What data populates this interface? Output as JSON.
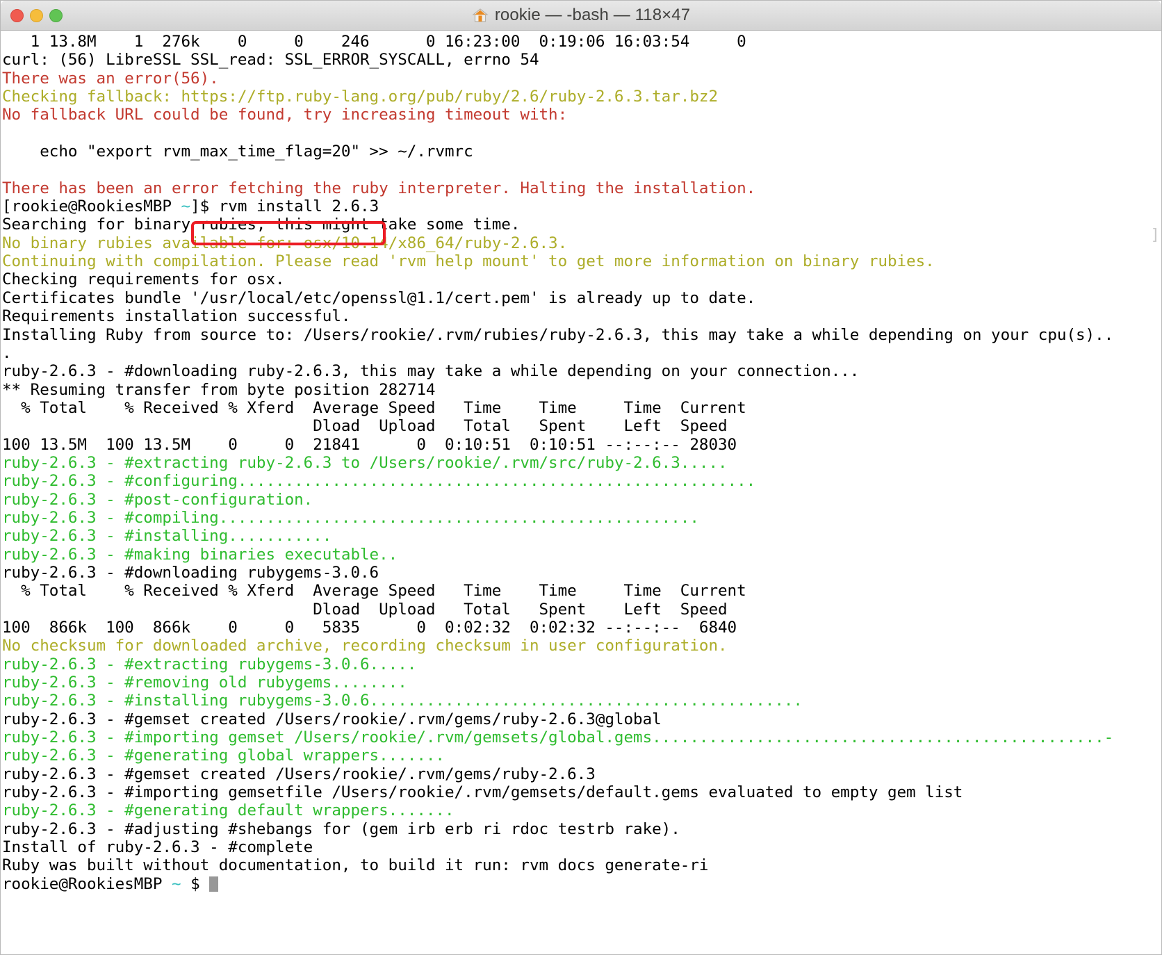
{
  "window": {
    "title": "rookie — -bash — 118×47",
    "icon": "home-icon",
    "buttons": {
      "close": "close",
      "minimize": "minimize",
      "zoom": "zoom"
    }
  },
  "colors": {
    "red": "#c33a30",
    "yellow": "#adad29",
    "green": "#2fbc2f",
    "cyan": "#36bfbf",
    "white": "#000000",
    "highlight": "#ec1c24",
    "cursor": "#989898"
  },
  "terminal": {
    "right_edge_bracket": "]",
    "cursor": "block",
    "prompt_final": {
      "user_host": "rookie@RookiesMBP ",
      "path": "~",
      "sigil": " $ "
    },
    "lines": [
      {
        "id": "l1",
        "color": "white",
        "text": "   1 13.8M    1  276k    0     0    246      0 16:23:00  0:19:06 16:03:54     0"
      },
      {
        "id": "l2",
        "color": "white",
        "text": "curl: (56) LibreSSL SSL_read: SSL_ERROR_SYSCALL, errno 54"
      },
      {
        "id": "l3",
        "color": "red",
        "text": "There was an error(56)."
      },
      {
        "id": "l4",
        "color": "yellow",
        "text": "Checking fallback: https://ftp.ruby-lang.org/pub/ruby/2.6/ruby-2.6.3.tar.bz2"
      },
      {
        "id": "l5",
        "color": "red",
        "text": "No fallback URL could be found, try increasing timeout with:"
      },
      {
        "id": "l6",
        "color": "white",
        "text": ""
      },
      {
        "id": "l7",
        "color": "white",
        "text": "    echo \"export rvm_max_time_flag=20\" >> ~/.rvmrc"
      },
      {
        "id": "l8",
        "color": "white",
        "text": ""
      },
      {
        "id": "l9",
        "color": "red",
        "text": "There has been an error fetching the ruby interpreter. Halting the installation."
      },
      {
        "id": "l10",
        "color": "prompt",
        "prompt_prefix": "[rookie@RookiesMBP ",
        "prompt_path": "~",
        "prompt_sigil": "]$ ",
        "text": "rvm install 2.6.3",
        "highlighted": true
      },
      {
        "id": "l11",
        "color": "white",
        "text": "Searching for binary rubies, this might take some time."
      },
      {
        "id": "l12",
        "color": "yellow",
        "text": "No binary rubies available for: osx/10.14/x86_64/ruby-2.6.3."
      },
      {
        "id": "l13",
        "color": "yellow",
        "text": "Continuing with compilation. Please read 'rvm help mount' to get more information on binary rubies."
      },
      {
        "id": "l14",
        "color": "white",
        "text": "Checking requirements for osx."
      },
      {
        "id": "l15",
        "color": "white",
        "text": "Certificates bundle '/usr/local/etc/openssl@1.1/cert.pem' is already up to date."
      },
      {
        "id": "l16",
        "color": "white",
        "text": "Requirements installation successful."
      },
      {
        "id": "l17",
        "color": "white",
        "text": "Installing Ruby from source to: /Users/rookie/.rvm/rubies/ruby-2.6.3, this may take a while depending on your cpu(s).."
      },
      {
        "id": "l18",
        "color": "white",
        "text": "."
      },
      {
        "id": "l19",
        "color": "white",
        "text": "ruby-2.6.3 - #downloading ruby-2.6.3, this may take a while depending on your connection..."
      },
      {
        "id": "l20",
        "color": "white",
        "text": "** Resuming transfer from byte position 282714"
      },
      {
        "id": "l21",
        "color": "white",
        "text": "  % Total    % Received % Xferd  Average Speed   Time    Time     Time  Current"
      },
      {
        "id": "l22",
        "color": "white",
        "text": "                                 Dload  Upload   Total   Spent    Left  Speed"
      },
      {
        "id": "l23",
        "color": "white",
        "text": "100 13.5M  100 13.5M    0     0  21841      0  0:10:51  0:10:51 --:--:-- 28030"
      },
      {
        "id": "l24",
        "color": "green",
        "text": "ruby-2.6.3 - #extracting ruby-2.6.3 to /Users/rookie/.rvm/src/ruby-2.6.3....."
      },
      {
        "id": "l25",
        "color": "green",
        "text": "ruby-2.6.3 - #configuring......................................................."
      },
      {
        "id": "l26",
        "color": "green",
        "text": "ruby-2.6.3 - #post-configuration."
      },
      {
        "id": "l27",
        "color": "green",
        "text": "ruby-2.6.3 - #compiling..................................................."
      },
      {
        "id": "l28",
        "color": "green",
        "text": "ruby-2.6.3 - #installing..........."
      },
      {
        "id": "l29",
        "color": "green",
        "text": "ruby-2.6.3 - #making binaries executable.."
      },
      {
        "id": "l30",
        "color": "white",
        "text": "ruby-2.6.3 - #downloading rubygems-3.0.6"
      },
      {
        "id": "l31",
        "color": "white",
        "text": "  % Total    % Received % Xferd  Average Speed   Time    Time     Time  Current"
      },
      {
        "id": "l32",
        "color": "white",
        "text": "                                 Dload  Upload   Total   Spent    Left  Speed"
      },
      {
        "id": "l33",
        "color": "white",
        "text": "100  866k  100  866k    0     0   5835      0  0:02:32  0:02:32 --:--:--  6840"
      },
      {
        "id": "l34",
        "color": "yellow",
        "text": "No checksum for downloaded archive, recording checksum in user configuration."
      },
      {
        "id": "l35",
        "color": "green",
        "text": "ruby-2.6.3 - #extracting rubygems-3.0.6....."
      },
      {
        "id": "l36",
        "color": "green",
        "text": "ruby-2.6.3 - #removing old rubygems........"
      },
      {
        "id": "l37",
        "color": "green",
        "text": "ruby-2.6.3 - #installing rubygems-3.0.6.............................................."
      },
      {
        "id": "l38",
        "color": "white",
        "text": "ruby-2.6.3 - #gemset created /Users/rookie/.rvm/gems/ruby-2.6.3@global"
      },
      {
        "id": "l39",
        "color": "green",
        "text": "ruby-2.6.3 - #importing gemset /Users/rookie/.rvm/gemsets/global.gems................................................-"
      },
      {
        "id": "l40",
        "color": "green",
        "text": "ruby-2.6.3 - #generating global wrappers......."
      },
      {
        "id": "l41",
        "color": "white",
        "text": "ruby-2.6.3 - #gemset created /Users/rookie/.rvm/gems/ruby-2.6.3"
      },
      {
        "id": "l42",
        "color": "white",
        "text": "ruby-2.6.3 - #importing gemsetfile /Users/rookie/.rvm/gemsets/default.gems evaluated to empty gem list"
      },
      {
        "id": "l43",
        "color": "green",
        "text": "ruby-2.6.3 - #generating default wrappers......."
      },
      {
        "id": "l44",
        "color": "white",
        "text": "ruby-2.6.3 - #adjusting #shebangs for (gem irb erb ri rdoc testrb rake)."
      },
      {
        "id": "l45",
        "color": "white",
        "text": "Install of ruby-2.6.3 - #complete"
      },
      {
        "id": "l46",
        "color": "white",
        "text": "Ruby was built without documentation, to build it run: rvm docs generate-ri"
      }
    ]
  }
}
